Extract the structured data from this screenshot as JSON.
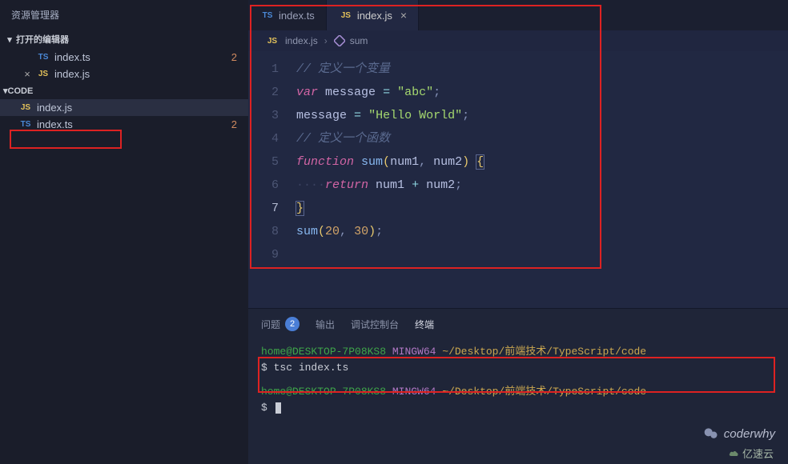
{
  "sidebar": {
    "title": "资源管理器",
    "open_editors_label": "打开的编辑器",
    "code_section_label": "CODE",
    "open_editors": [
      {
        "icon": "TS",
        "icon_class": "ts-icon",
        "name": "index.ts",
        "modified": "2",
        "closable": false
      },
      {
        "icon": "JS",
        "icon_class": "js-icon",
        "name": "index.js",
        "modified": "",
        "closable": true
      }
    ],
    "code_files": [
      {
        "icon": "JS",
        "icon_class": "js-icon",
        "name": "index.js",
        "modified": ""
      },
      {
        "icon": "TS",
        "icon_class": "ts-icon",
        "name": "index.ts",
        "modified": "2"
      }
    ]
  },
  "tabs": [
    {
      "icon": "TS",
      "icon_class": "ts-icon",
      "label": "index.ts",
      "active": false,
      "close": ""
    },
    {
      "icon": "JS",
      "icon_class": "js-icon",
      "label": "index.js",
      "active": true,
      "close": "×"
    }
  ],
  "breadcrumb": {
    "file_icon": "JS",
    "file_label": "index.js",
    "symbol_label": "sum"
  },
  "code": {
    "lines": [
      {
        "n": "1",
        "html": "<span class='tok-comment'>// 定义一个变量</span>"
      },
      {
        "n": "2",
        "html": "<span class='tok-keyword'>var</span> <span class='tok-var'>message</span> <span class='tok-op'>=</span> <span class='tok-string'>\"abc\"</span><span class='tok-punct'>;</span>"
      },
      {
        "n": "3",
        "html": "<span class='tok-var'>message</span> <span class='tok-op'>=</span> <span class='tok-string'>\"Hello World\"</span><span class='tok-punct'>;</span>"
      },
      {
        "n": "4",
        "html": "<span class='tok-comment'>// 定义一个函数</span>"
      },
      {
        "n": "5",
        "html": "<span class='tok-keyword'>function</span> <span class='tok-func'>sum</span><span class='tok-brace-yellow'>(</span><span class='tok-var'>num1</span><span class='tok-punct'>,</span> <span class='tok-var'>num2</span><span class='tok-brace-yellow'>)</span> <span class='tok-brace-active'>{</span>"
      },
      {
        "n": "6",
        "html": "<span class='tok-ws'>····</span><span class='tok-keyword'>return</span> <span class='tok-var'>num1</span> <span class='tok-op'>+</span> <span class='tok-var'>num2</span><span class='tok-punct'>;</span>"
      },
      {
        "n": "7",
        "html": "<span class='tok-brace-active'>}</span>",
        "active": true
      },
      {
        "n": "8",
        "html": "<span class='tok-func'>sum</span><span class='tok-brace-yellow'>(</span><span class='tok-number'>20</span><span class='tok-punct'>,</span> <span class='tok-number'>30</span><span class='tok-brace-yellow'>)</span><span class='tok-punct'>;</span>"
      },
      {
        "n": "9",
        "html": ""
      }
    ]
  },
  "panel": {
    "tabs": {
      "problems": "问题",
      "problems_count": "2",
      "output": "输出",
      "debug_console": "调试控制台",
      "terminal": "终端"
    }
  },
  "terminal": {
    "line1_user": "home@DESKTOP-7P08KS8",
    "line1_shell": "MINGW64",
    "line1_path": "~/Desktop/前端技术/TypeScript/code",
    "line2_prompt": "$",
    "line2_cmd": "tsc index.ts",
    "line3_user": "home@DESKTOP-7P08KS8",
    "line3_shell": "MINGW64",
    "line3_path": "~/Desktop/前端技术/TypeScript/code",
    "line4_prompt": "$"
  },
  "watermark": "coderwhy",
  "footer": "亿速云"
}
